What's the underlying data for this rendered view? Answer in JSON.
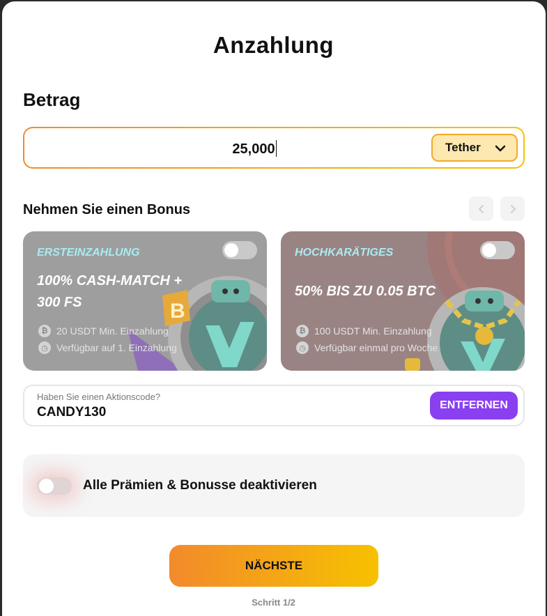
{
  "modal": {
    "title": "Anzahlung"
  },
  "amount": {
    "label": "Betrag",
    "value": "25,000",
    "currency": "Tether"
  },
  "bonus": {
    "title": "Nehmen Sie einen Bonus",
    "cards": [
      {
        "type": "ERSTEINZAHLUNG",
        "headline_1": "100% CASH-MATCH +",
        "headline_2": "300 FS",
        "min": "20 USDT Min. Einzahlung",
        "availability": "Verfügbar auf 1. Einzahlung",
        "enabled": false
      },
      {
        "type": "HOCHKARÄTIGES",
        "headline_1": "50% BIS ZU 0.05 BTC",
        "min": "100 USDT Min. Einzahlung",
        "availability": "Verfügbar einmal pro Woche",
        "enabled": false
      }
    ]
  },
  "promo": {
    "placeholder": "Haben Sie einen Aktionscode?",
    "value": "CANDY130",
    "remove_label": "ENTFERNEN"
  },
  "disable_all": {
    "label": "Alle Prämien & Bonusse deaktivieren",
    "enabled": false
  },
  "footer": {
    "next_label": "NÄCHSTE",
    "step": "Schritt 1/2"
  },
  "colors": {
    "accent_orange": "#f38a2c",
    "accent_yellow": "#f6c100",
    "purple_button": "#8a3ff0",
    "card_type_text": "#a8ecf2"
  }
}
